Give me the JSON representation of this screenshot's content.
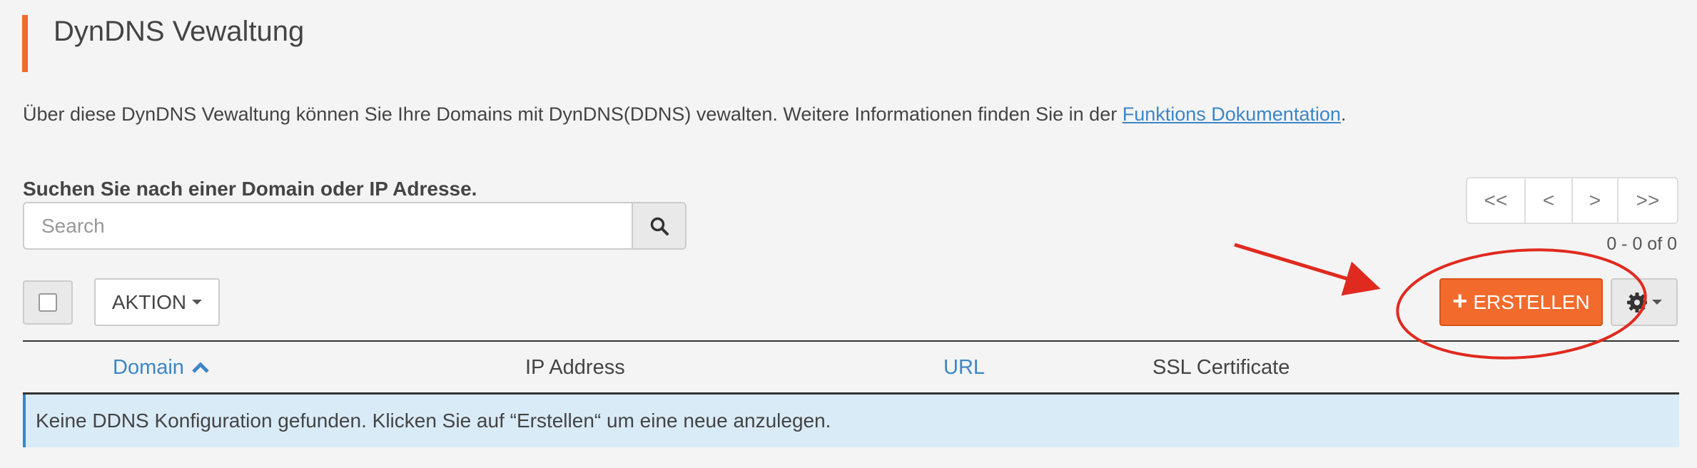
{
  "header": {
    "title": "DynDNS Vewaltung"
  },
  "intro": {
    "text": "Über diese DynDNS Vewaltung können Sie Ihre Domains mit DynDNS(DDNS) vewalten. Weitere Informationen finden Sie in der ",
    "link_label": "Funktions Dokumentation",
    "suffix": "."
  },
  "search": {
    "label": "Suchen Sie nach einer Domain oder IP Adresse.",
    "placeholder": "Search",
    "button_icon": "search-icon"
  },
  "pagination": {
    "first": "<<",
    "prev": "<",
    "next": ">",
    "last": ">>",
    "range": "0 - 0 of 0"
  },
  "toolbar": {
    "aktion_label": "AKTION",
    "erstellen_label": "ERSTELLEN",
    "settings_icon": "gear-icon"
  },
  "table": {
    "columns": [
      {
        "label": "Domain",
        "sortable": true,
        "sorted": "asc"
      },
      {
        "label": "IP Address",
        "sortable": false
      },
      {
        "label": "URL",
        "sortable": true
      },
      {
        "label": "SSL Certificate",
        "sortable": false
      }
    ],
    "empty_message": "Keine DDNS Konfiguration gefunden. Klicken Sie auf “Erstellen“ um eine neue anzulegen."
  },
  "colors": {
    "accent": "#f26b2c",
    "link": "#3d86c6",
    "annotation": "#e02a1f",
    "empty_row_bg": "#d9ebf7"
  }
}
